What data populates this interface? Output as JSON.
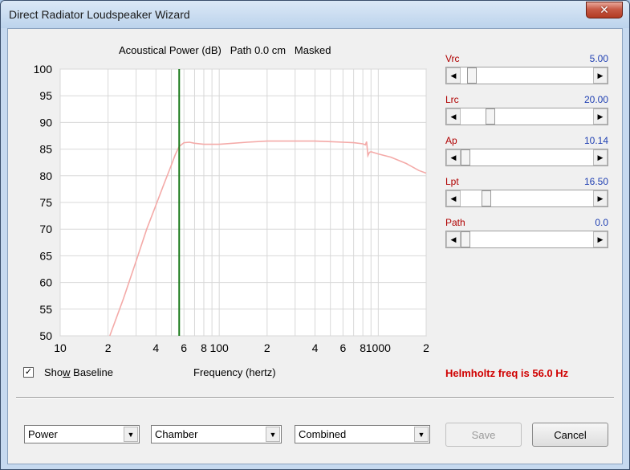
{
  "window": {
    "title": "Direct Radiator Loudspeaker Wizard",
    "close_label": "✕"
  },
  "chart": {
    "title": "Acoustical Power (dB)   Path 0.0 cm   Masked",
    "xlabel": "Frequency (hertz)"
  },
  "chart_data": {
    "type": "line",
    "title": "Acoustical Power (dB)   Path 0.0 cm   Masked",
    "xlabel": "Frequency (hertz)",
    "ylabel": "",
    "x_scale": "log",
    "xlim": [
      10,
      2000
    ],
    "ylim": [
      50,
      100
    ],
    "y_ticks": [
      100,
      95,
      90,
      85,
      80,
      75,
      70,
      65,
      60,
      55,
      50
    ],
    "x_tick_labels": [
      {
        "x": 10,
        "label": "10"
      },
      {
        "x": 20,
        "label": "2"
      },
      {
        "x": 40,
        "label": "4"
      },
      {
        "x": 60,
        "label": "6"
      },
      {
        "x": 80,
        "label": "8"
      },
      {
        "x": 100,
        "label": "100"
      },
      {
        "x": 200,
        "label": "2"
      },
      {
        "x": 400,
        "label": "4"
      },
      {
        "x": 600,
        "label": "6"
      },
      {
        "x": 800,
        "label": "8"
      },
      {
        "x": 1000,
        "label": "1000"
      },
      {
        "x": 2000,
        "label": "2"
      }
    ],
    "grid": true,
    "marker": {
      "x": 56,
      "color": "#1a7a1a"
    },
    "series": [
      {
        "color": "#f4aaa8",
        "x": [
          20.5,
          25,
          30,
          35,
          40,
          45,
          50,
          53,
          56,
          60,
          65,
          70,
          80,
          100,
          150,
          200,
          300,
          400,
          500,
          600,
          700,
          800,
          830,
          845,
          860,
          880,
          900,
          1000,
          1200,
          1500,
          1800,
          2000
        ],
        "y": [
          50,
          57,
          64,
          70,
          74.5,
          78.5,
          82,
          84,
          85.5,
          86.2,
          86.3,
          86.1,
          85.9,
          85.9,
          86.3,
          86.5,
          86.5,
          86.5,
          86.4,
          86.3,
          86.2,
          86.0,
          85.8,
          86.4,
          83.8,
          84.4,
          84.5,
          84.1,
          83.5,
          82.3,
          81.0,
          80.5
        ]
      }
    ]
  },
  "sliders": [
    {
      "label": "Vrc",
      "value": "5.00",
      "position": 0.05
    },
    {
      "label": "Lrc",
      "value": "20.00",
      "position": 0.2
    },
    {
      "label": "Ap",
      "value": "10.14",
      "position": 0.0
    },
    {
      "label": "Lpt",
      "value": "16.50",
      "position": 0.17
    },
    {
      "label": "Path",
      "value": "0.0",
      "position": 0.0
    }
  ],
  "baseline": {
    "label_prefix": "Sho",
    "label_hot": "w",
    "label_suffix": " Baseline",
    "checked_mark": "✓"
  },
  "helmholtz_text": "Helmholtz freq is 56.0 Hz",
  "dropdowns": {
    "mode": "Power",
    "chamber": "Chamber",
    "combined": "Combined",
    "arrow": "▼"
  },
  "buttons": {
    "save": "Save",
    "cancel": "Cancel"
  },
  "arrows": {
    "left": "◀",
    "right": "▶"
  }
}
